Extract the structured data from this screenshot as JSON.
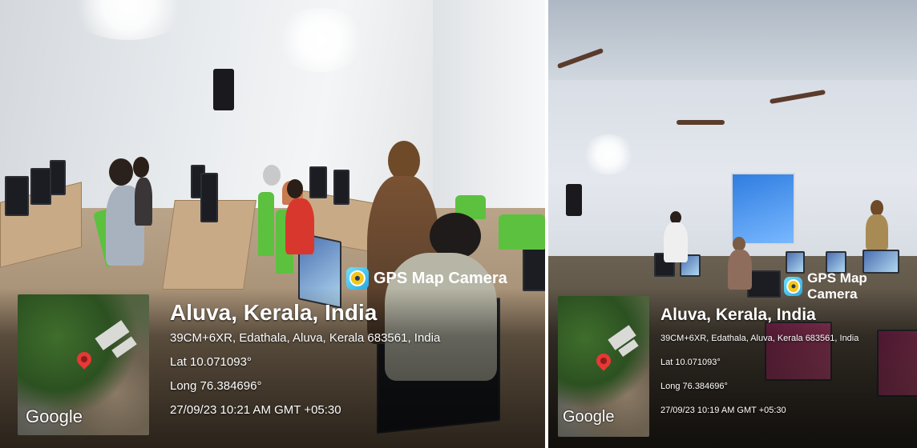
{
  "photos": [
    {
      "brand": {
        "label": "GPS Map Camera",
        "icon": "gps-map-camera-icon"
      },
      "map": {
        "provider_label": "Google",
        "pin_icon": "map-pin-icon"
      },
      "location": {
        "title": "Aluva, Kerala, India",
        "address": "39CM+6XR, Edathala, Aluva, Kerala 683561, India",
        "lat": "Lat 10.071093°",
        "long": "Long 76.384696°",
        "datetime": "27/09/23 10:21 AM GMT +05:30"
      }
    },
    {
      "brand": {
        "label": "GPS Map Camera",
        "icon": "gps-map-camera-icon"
      },
      "map": {
        "provider_label": "Google",
        "pin_icon": "map-pin-icon"
      },
      "location": {
        "title": "Aluva, Kerala, India",
        "address": "39CM+6XR, Edathala, Aluva, Kerala 683561, India",
        "lat": "Lat 10.071093°",
        "long": "Long 76.384696°",
        "datetime": "27/09/23 10:19 AM GMT +05:30"
      }
    }
  ],
  "colors": {
    "chair_green": "#5cc13e",
    "pin_red": "#e53935",
    "brand_blue": "#2aa6e0"
  }
}
